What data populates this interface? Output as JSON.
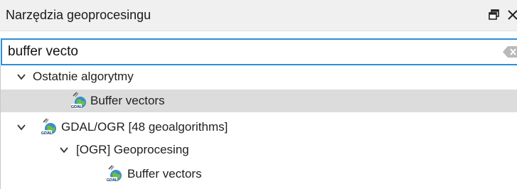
{
  "panel": {
    "title": "Narzędzia geoprocesingu",
    "float_icon": "float-window-icon",
    "close_icon": "close-icon"
  },
  "search": {
    "value": "buffer vecto",
    "clear_icon": "clear-input-icon"
  },
  "tree": {
    "recent": {
      "label": "Ostatnie algorytmy",
      "expanded": true,
      "children": [
        {
          "label": "Buffer vectors",
          "icon": "gdal-icon",
          "selected": true
        }
      ]
    },
    "provider": {
      "label": "GDAL/OGR [48 geoalgorithms]",
      "icon": "gdal-icon",
      "expanded": true,
      "group": {
        "label": "[OGR] Geoprocesing",
        "expanded": true,
        "children": [
          {
            "label": "Buffer vectors",
            "icon": "gdal-icon",
            "selected": false
          }
        ]
      }
    }
  },
  "colors": {
    "accent": "#2b8fd8",
    "selection": "#dcdcdc",
    "header_bg": "#f0f0f0"
  }
}
